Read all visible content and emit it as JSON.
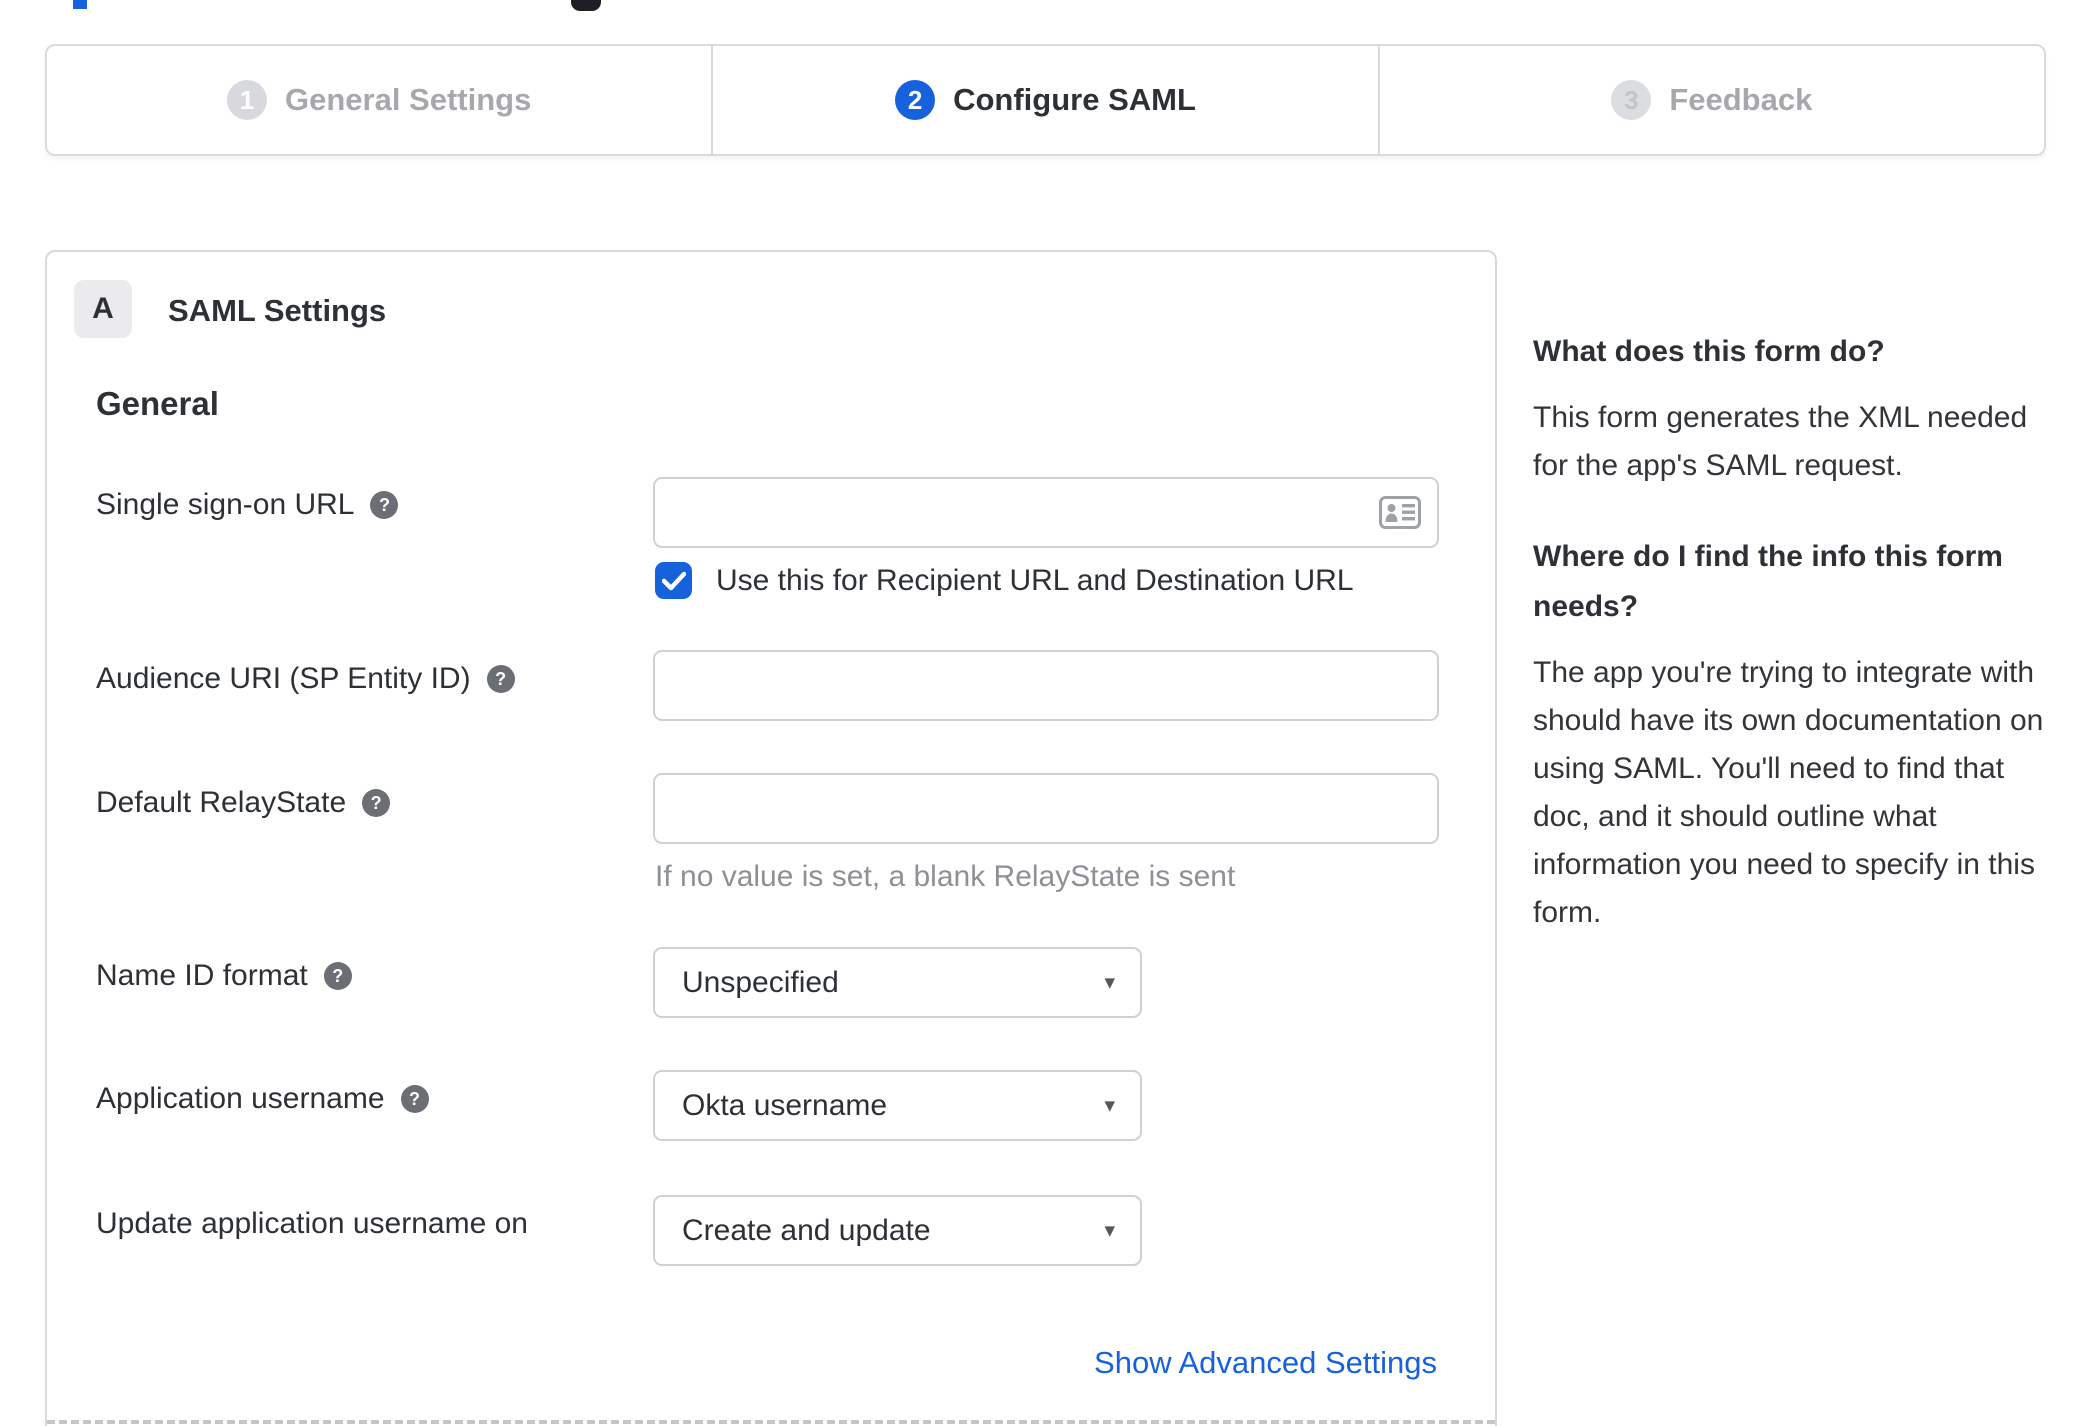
{
  "icons": {
    "help_glyph": "?",
    "caret_glyph": "▾"
  },
  "colors": {
    "accent_blue": "#1662dd",
    "link_blue": "#1662dd",
    "inactive_gray": "#a6a8ab",
    "helper_gray": "#8d9095"
  },
  "stepper": {
    "steps": [
      {
        "number": "1",
        "label": "General Settings"
      },
      {
        "number": "2",
        "label": "Configure SAML"
      },
      {
        "number": "3",
        "label": "Feedback"
      }
    ]
  },
  "panel": {
    "badge": "A",
    "title": "SAML Settings",
    "section": "General",
    "fields": {
      "sso": {
        "label": "Single sign-on URL",
        "value": ""
      },
      "sso_checkbox": {
        "label": "Use this for Recipient URL and Destination URL",
        "checked": true
      },
      "audience": {
        "label": "Audience URI (SP Entity ID)",
        "value": ""
      },
      "relay": {
        "label": "Default RelayState",
        "value": "",
        "helper": "If no value is set, a blank RelayState is sent"
      },
      "name_id": {
        "label": "Name ID format",
        "value": "Unspecified"
      },
      "app_user": {
        "label": "Application username",
        "value": "Okta username"
      },
      "update_user": {
        "label": "Update application username on",
        "value": "Create and update"
      }
    },
    "advanced_link": "Show Advanced Settings"
  },
  "sidebar": {
    "q1": {
      "title": "What does this form do?",
      "body": "This form generates the XML needed for the app's SAML request."
    },
    "q2": {
      "title": "Where do I find the info this form needs?",
      "body": "The app you're trying to integrate with should have its own documentation on using SAML. You'll need to find that doc, and it should outline what information you need to specify in this form."
    }
  }
}
